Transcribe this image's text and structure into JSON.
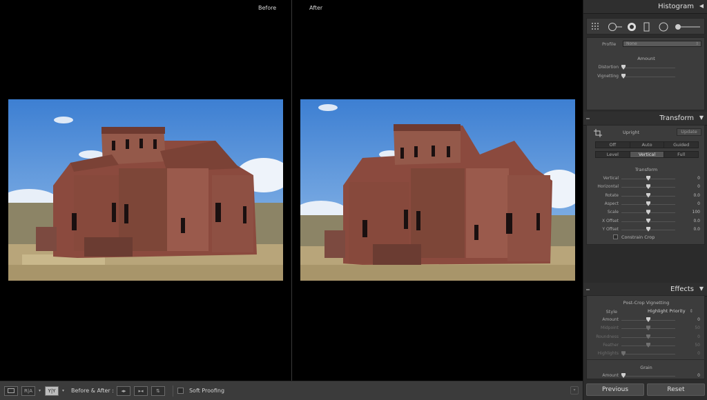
{
  "compare": {
    "before_label": "Before",
    "after_label": "After"
  },
  "toolbar": {
    "view_loupe_icon": "loupe-view-icon",
    "view_ra_label": "R|A",
    "view_yy_label": "Y|Y",
    "before_after_label": "Before & After :",
    "soft_proofing_label": "Soft Proofing"
  },
  "panel": {
    "histogram_title": "Histogram",
    "lens": {
      "profile_label": "Profile",
      "profile_value": "None",
      "amount_heading": "Amount",
      "sliders": [
        {
          "label": "Distortion",
          "level": 0.0
        },
        {
          "label": "Vignetting",
          "level": 0.0
        }
      ]
    },
    "transform": {
      "title": "Transform",
      "upright_label": "Upright",
      "update_label": "Update",
      "buttons_row1": [
        "Off",
        "Auto",
        "Guided"
      ],
      "buttons_row2": [
        "Level",
        "Vertical",
        "Full"
      ],
      "transform_heading": "Transform",
      "sliders": [
        {
          "label": "Vertical",
          "value": "0",
          "level": 0.5
        },
        {
          "label": "Horizontal",
          "value": "0",
          "level": 0.5
        },
        {
          "label": "Rotate",
          "value": "0.0",
          "level": 0.5
        },
        {
          "label": "Aspect",
          "value": "0",
          "level": 0.5
        },
        {
          "label": "Scale",
          "value": "100",
          "level": 0.5
        },
        {
          "label": "X Offset",
          "value": "0.0",
          "level": 0.5
        },
        {
          "label": "Y Offset",
          "value": "0.0",
          "level": 0.5
        }
      ],
      "constrain_label": "Constrain Crop"
    },
    "effects": {
      "title": "Effects",
      "vignette_heading": "Post-Crop Vignetting",
      "style_label": "Style",
      "style_value": "Highlight Priority",
      "sliders": [
        {
          "label": "Amount",
          "value": "0",
          "level": 0.5,
          "dim": false
        },
        {
          "label": "Midpoint",
          "value": "50",
          "level": 0.5,
          "dim": true
        },
        {
          "label": "Roundness",
          "value": "0",
          "level": 0.5,
          "dim": true
        },
        {
          "label": "Feather",
          "value": "50",
          "level": 0.5,
          "dim": true
        },
        {
          "label": "Highlights",
          "value": "0",
          "level": 0.0,
          "dim": true
        }
      ],
      "grain_heading": "Grain",
      "grain_amount_label": "Amount",
      "grain_amount_value": "0"
    },
    "previous_label": "Previous",
    "reset_label": "Reset"
  }
}
